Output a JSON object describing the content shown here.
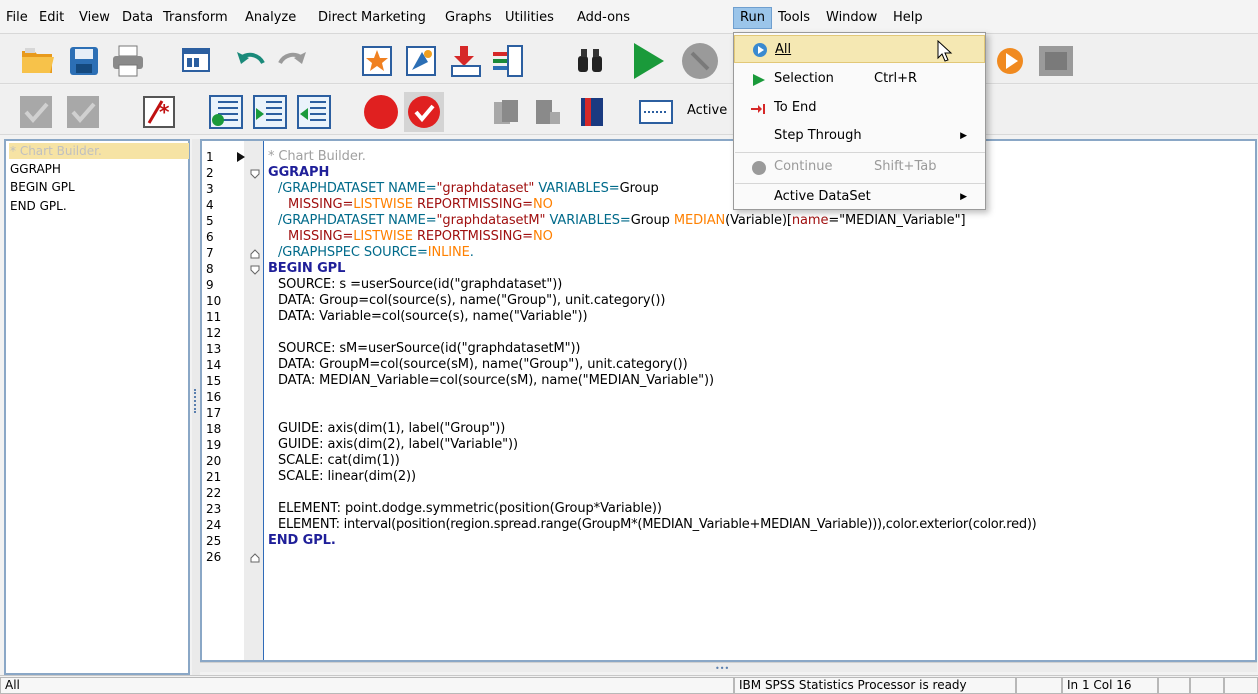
{
  "menubar": {
    "items": [
      "File",
      "Edit",
      "View",
      "Data",
      "Transform",
      "Analyze",
      "Direct Marketing",
      "Graphs",
      "Utilities",
      "Add-ons",
      "Run",
      "Tools",
      "Window",
      "Help"
    ]
  },
  "toolbar2": {
    "active_dataset_label": "Active"
  },
  "navigation": {
    "items": [
      "* Chart Builder.",
      "GGRAPH",
      "BEGIN GPL",
      "END GPL."
    ]
  },
  "editor": {
    "line_numbers": [
      "1",
      "2",
      "3",
      "4",
      "5",
      "6",
      "7",
      "8",
      "9",
      "10",
      "11",
      "12",
      "13",
      "14",
      "15",
      "16",
      "17",
      "18",
      "19",
      "20",
      "21",
      "22",
      "23",
      "24",
      "25",
      "26"
    ],
    "l1": "* Chart Builder.",
    "l2": "GGRAPH",
    "l3_a": "/GRAPHDATASET NAME=",
    "l3_b": "\"graphdataset\"",
    "l3_c": " VARIABLES=",
    "l3_d": "Group",
    "l4_a": "MISSING=",
    "l4_b": "LISTWISE",
    "l4_c": " REPORTMISSING=",
    "l4_d": "NO",
    "l5_a": "/GRAPHDATASET NAME=",
    "l5_b": "\"graphdatasetM\"",
    "l5_c": " VARIABLES=",
    "l5_d": "Group ",
    "l5_e": "MEDIAN",
    "l5_f": "(Variable)[",
    "l5_g": "name",
    "l5_h": "=\"MEDIAN_Variable\"]",
    "l6_a": "MISSING=",
    "l6_b": "LISTWISE",
    "l6_c": " REPORTMISSING=",
    "l6_d": "NO",
    "l7_a": "/GRAPHSPEC SOURCE=",
    "l7_b": "INLINE",
    "l7_c": ".",
    "l8": "BEGIN GPL",
    "l9": "SOURCE: s =userSource(id(\"graphdataset\"))",
    "l10": "DATA: Group=col(source(s), name(\"Group\"), unit.category())",
    "l11": "DATA: Variable=col(source(s), name(\"Variable\"))",
    "l13": "SOURCE: sM=userSource(id(\"graphdatasetM\"))",
    "l14": "DATA: GroupM=col(source(sM), name(\"Group\"), unit.category())",
    "l15": "DATA: MEDIAN_Variable=col(source(sM), name(\"MEDIAN_Variable\"))",
    "l18": "GUIDE: axis(dim(1), label(\"Group\"))",
    "l19": "GUIDE: axis(dim(2), label(\"Variable\"))",
    "l20": "SCALE: cat(dim(1))",
    "l21": "SCALE: linear(dim(2))",
    "l23": "ELEMENT: point.dodge.symmetric(position(Group*Variable))",
    "l24": "ELEMENT: interval(position(region.spread.range(GroupM*(MEDIAN_Variable+MEDIAN_Variable))),color.exterior(color.red))",
    "l25": "END GPL."
  },
  "run_menu": {
    "all": "All",
    "selection": "Selection",
    "selection_shortcut": "Ctrl+R",
    "to_end": "To End",
    "step_through": "Step Through",
    "continue": "Continue",
    "continue_shortcut": "Shift+Tab",
    "active_dataset": "Active DataSet"
  },
  "statusbar": {
    "left": "All",
    "processor": "IBM SPSS Statistics Processor is ready",
    "position": "In 1 Col 16"
  },
  "colors": {
    "keyword": "#1f1f99",
    "command": "#a01010",
    "value": "#ff8000",
    "gutter_line": "#2f6bb8",
    "highlight": "#f5e8b3"
  }
}
